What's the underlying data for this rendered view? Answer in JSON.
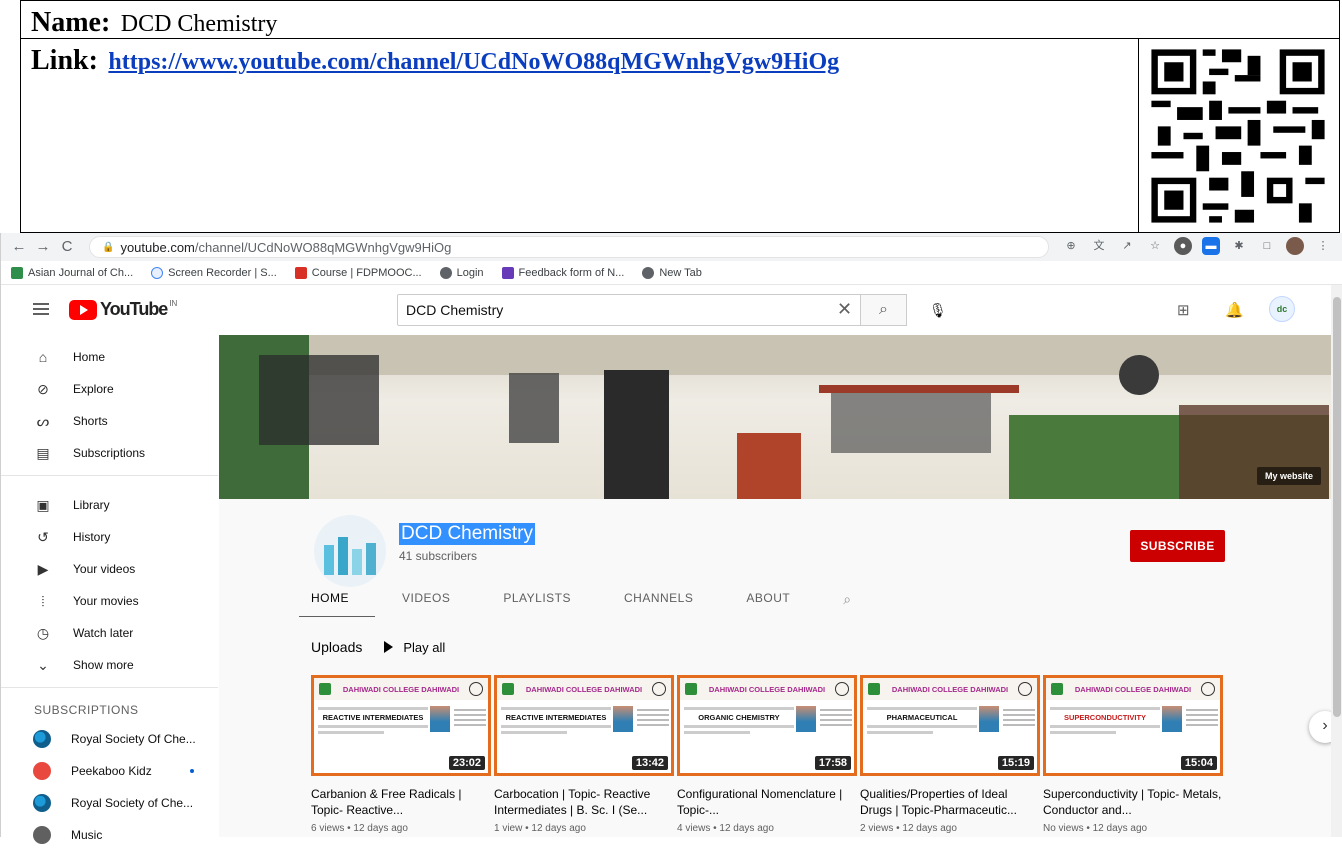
{
  "doc": {
    "name_label": "Name:",
    "name_value": "DCD Chemistry",
    "link_label": "Link:",
    "link_value": "https://www.youtube.com/channel/UCdNoWO88qMGWnhgVgw9HiOg"
  },
  "browser": {
    "url_host": "youtube.com",
    "url_path": "/channel/UCdNoWO88qMGWnhgVgw9HiOg",
    "bookmarks": [
      "Asian Journal of Ch...",
      "Screen Recorder | S...",
      "Course | FDPMOOC...",
      "Login",
      "Feedback form of N...",
      "New Tab"
    ]
  },
  "youtube": {
    "logo": "YouTube",
    "logo_region": "IN",
    "search_value": "DCD Chemistry",
    "sidebar": {
      "items": [
        "Home",
        "Explore",
        "Shorts",
        "Subscriptions",
        "Library",
        "History",
        "Your videos",
        "Your movies",
        "Watch later",
        "Show more"
      ],
      "icons": [
        "home-icon",
        "explore-icon",
        "shorts-icon",
        "subscriptions-icon",
        "library-icon",
        "history-icon",
        "your-videos-icon",
        "your-movies-icon",
        "watch-later-icon",
        "chevron-down-icon"
      ],
      "subscriptions_heading": "SUBSCRIPTIONS",
      "subscriptions": [
        "Royal Society Of Che...",
        "Peekaboo Kidz",
        "Royal Society of Che...",
        "Music"
      ]
    },
    "banner_link": "My website",
    "channel": {
      "name": "DCD Chemistry",
      "subscribers": "41 subscribers",
      "subscribe_label": "SUBSCRIBE",
      "tabs": [
        "HOME",
        "VIDEOS",
        "PLAYLISTS",
        "CHANNELS",
        "ABOUT"
      ]
    },
    "uploads": {
      "heading": "Uploads",
      "play_all": "Play all",
      "videos": [
        {
          "thumb_college": "DAHIWADI COLLEGE DAHIWADI",
          "thumb_title": "REACTIVE INTERMEDIATES",
          "duration": "23:02",
          "title": "Carbanion & Free Radicals | Topic- Reactive...",
          "meta": "6 views • 12 days ago"
        },
        {
          "thumb_college": "DAHIWADI COLLEGE DAHIWADI",
          "thumb_title": "REACTIVE INTERMEDIATES",
          "duration": "13:42",
          "title": "Carbocation | Topic- Reactive Intermediates | B. Sc. I (Se...",
          "meta": "1 view • 12 days ago"
        },
        {
          "thumb_college": "DAHIWADI COLLEGE DAHIWADI",
          "thumb_title": "ORGANIC CHEMISTRY",
          "duration": "17:58",
          "title": "Configurational Nomenclature | Topic-...",
          "meta": "4 views • 12 days ago"
        },
        {
          "thumb_college": "DAHIWADI COLLEGE DAHIWADI",
          "thumb_title": "PHARMACEUTICAL",
          "duration": "15:19",
          "title": "Qualities/Properties of Ideal Drugs | Topic-Pharmaceutic...",
          "meta": "2 views • 12 days ago"
        },
        {
          "thumb_college": "DAHIWADI COLLEGE DAHIWADI",
          "thumb_title": "SUPERCONDUCTIVITY",
          "duration": "15:04",
          "title": "Superconductivity | Topic- Metals, Conductor and...",
          "meta": "No views • 12 days ago"
        }
      ]
    }
  }
}
